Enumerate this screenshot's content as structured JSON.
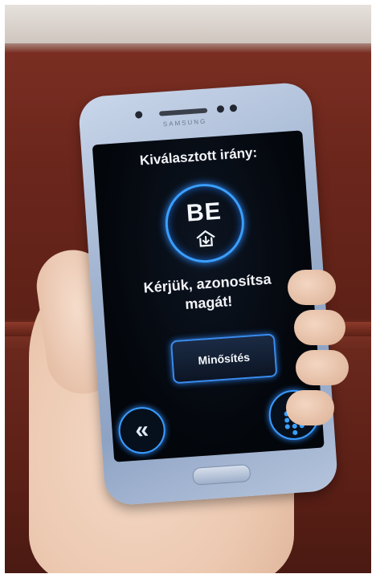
{
  "screen": {
    "title": "Kiválasztott irány:",
    "direction_badge": "BE",
    "prompt_line1": "Kérjük, azonosítsa",
    "prompt_line2": "magát!",
    "rate_button": "Minősítés",
    "back_button_glyph": "«"
  },
  "device": {
    "brand": "SAMSUNG"
  },
  "colors": {
    "accent_glow": "#3a9cff",
    "screen_bg": "#03060b",
    "phone_body": "#9fb2cf"
  },
  "icons": {
    "direction": "door-enter-icon",
    "back": "double-chevron-left-icon",
    "keypad": "keypad-icon"
  }
}
